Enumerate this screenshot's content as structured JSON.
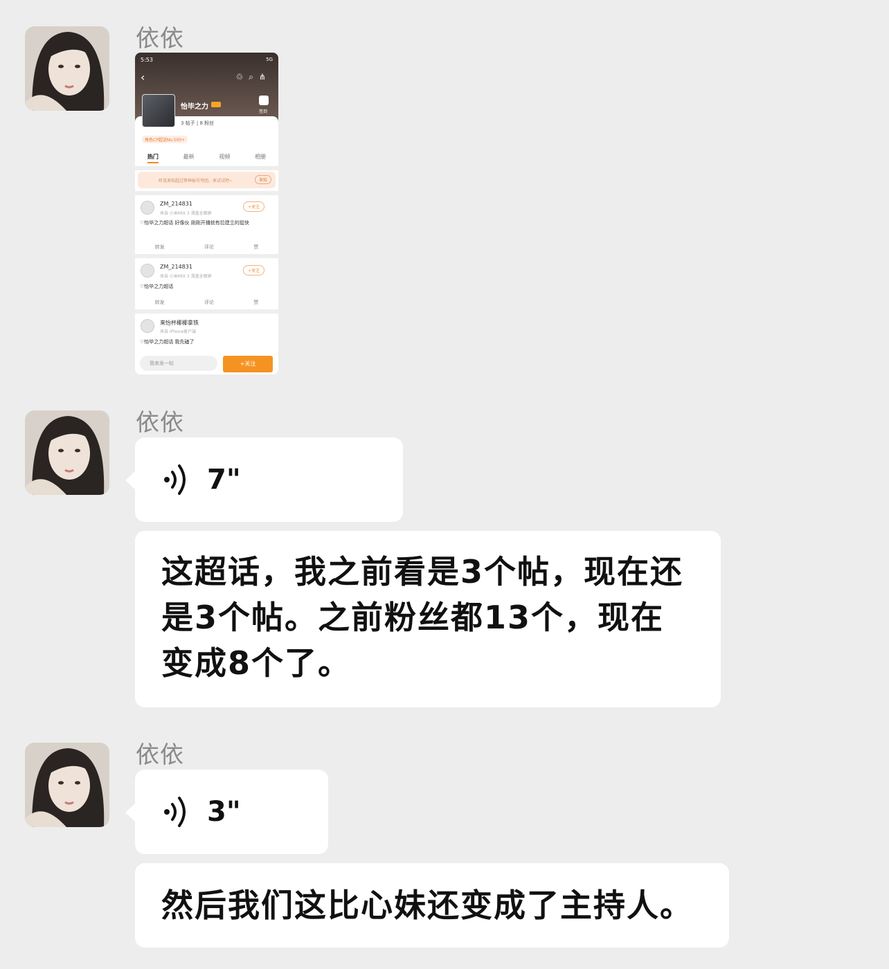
{
  "messages": [
    {
      "sender": "依依",
      "type": "image",
      "screenshot": {
        "status_time": "5:53",
        "status_right": "5G",
        "topic_name": "怡毕之力",
        "signin": "签到",
        "stats": "3 帖子 | 8 粉丝",
        "rank": "角色CP超话No.500+",
        "tabs": [
          "热门",
          "最新",
          "视频",
          "相册"
        ],
        "banner_text": "听说发帖超过等神秘号夺团，来试试吧~",
        "banner_button": "发帖",
        "posts": [
          {
            "author": "ZM_214831",
            "source": "来自 小米MIX 3 滑盖全面屏",
            "text": "♡怡毕之力超话 好像伙 刚刚开播就有拉建立的挺快",
            "follow": "+关注",
            "actions": [
              "转发",
              "评论",
              "赞"
            ]
          },
          {
            "author": "ZM_214831",
            "source": "来自 小米MIX 3 滑盖全面屏",
            "text": "♡怡毕之力超话",
            "follow": "+关注",
            "actions": [
              "转发",
              "评论",
              "赞"
            ]
          },
          {
            "author": "来怡杯椰椰拿铁",
            "source": "来自 iPhone客户端",
            "text": "♡怡毕之力超话  我先磕了"
          }
        ],
        "input_placeholder": "我来发一帖",
        "follow_button": "+关注"
      }
    },
    {
      "sender": "依依",
      "type": "voice",
      "duration": "7\""
    },
    {
      "type": "text",
      "text": "这超话，我之前看是3个帖，现在还是3个帖。之前粉丝都13个，现在变成8个了。"
    },
    {
      "sender": "依依",
      "type": "voice",
      "duration": "3\""
    },
    {
      "type": "text",
      "text": "然后我们这比心妹还变成了主持人。"
    }
  ]
}
